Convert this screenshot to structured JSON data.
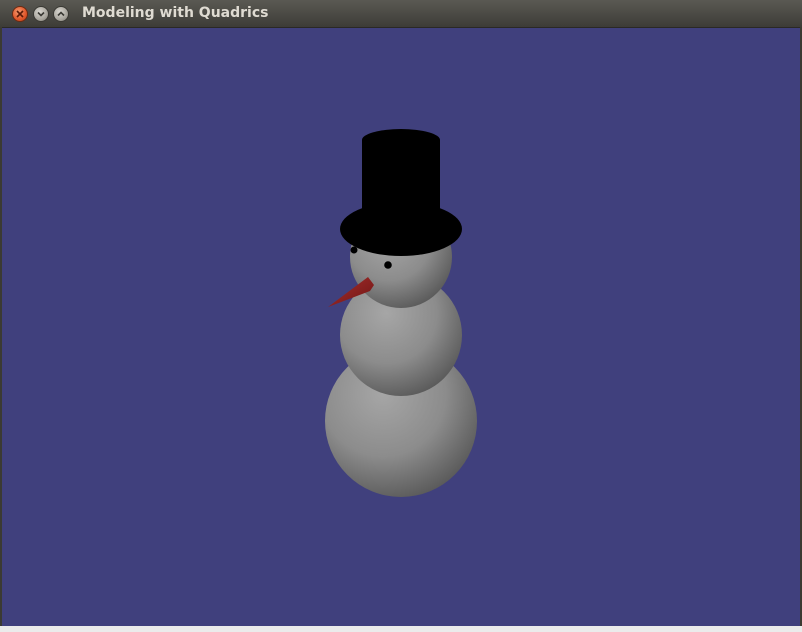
{
  "window": {
    "title": "Modeling with Quadrics"
  },
  "colors": {
    "background": "#40407d",
    "snow": "#8a8a8a",
    "hat": "#000000",
    "nose": "#8b1e1e",
    "eyes": "#000000"
  },
  "icons": {
    "close": "close-icon",
    "minimize": "minimize-icon",
    "maximize": "maximize-icon"
  }
}
